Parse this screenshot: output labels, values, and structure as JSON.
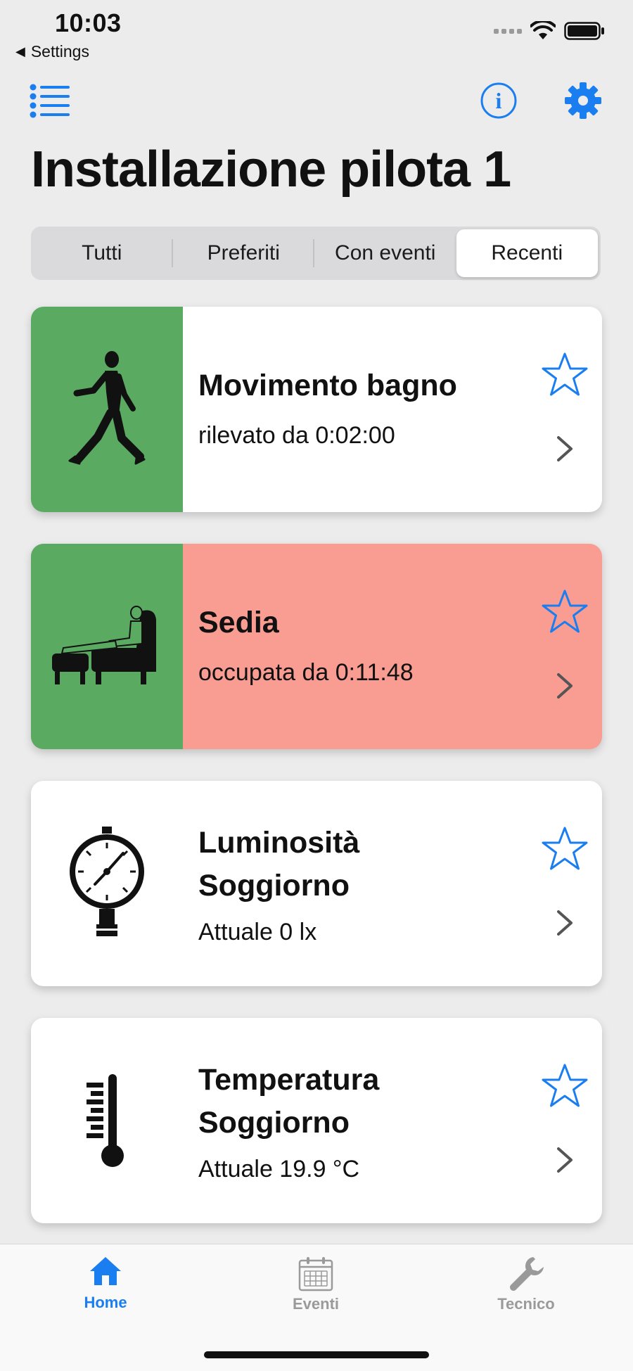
{
  "status_bar": {
    "time": "10:03",
    "back_label": "Settings"
  },
  "header": {
    "title": "Installazione pilota 1"
  },
  "segments": [
    {
      "label": "Tutti",
      "active": false
    },
    {
      "label": "Preferiti",
      "active": false
    },
    {
      "label": "Con eventi",
      "active": false
    },
    {
      "label": "Recenti",
      "active": true
    }
  ],
  "cards": [
    {
      "title": "Movimento bagno",
      "subtitle": "rilevato da 0:02:00",
      "icon": "walking-person-icon",
      "icon_bg": "#5aaa62",
      "content_bg": "#ffffff"
    },
    {
      "title": "Sedia",
      "subtitle": "occupata da 0:11:48",
      "icon": "armchair-icon",
      "icon_bg": "#5aaa62",
      "content_bg": "#f99c92"
    },
    {
      "title_line1": "Luminosità",
      "title_line2": "Soggiorno",
      "subtitle": "Attuale 0 lx",
      "icon": "gauge-icon",
      "icon_bg": "#ffffff",
      "content_bg": "#ffffff"
    },
    {
      "title_line1": "Temperatura",
      "title_line2": "Soggiorno",
      "subtitle": "Attuale 19.9 °C",
      "icon": "thermometer-icon",
      "icon_bg": "#ffffff",
      "content_bg": "#ffffff"
    }
  ],
  "tabbar": {
    "items": [
      {
        "label": "Home",
        "icon": "home-icon",
        "active": true
      },
      {
        "label": "Eventi",
        "icon": "calendar-icon",
        "active": false
      },
      {
        "label": "Tecnico",
        "icon": "wrench-icon",
        "active": false
      }
    ]
  },
  "colors": {
    "accent": "#1a7ef0",
    "inactive": "#9a9a9a",
    "background": "#ececec"
  }
}
